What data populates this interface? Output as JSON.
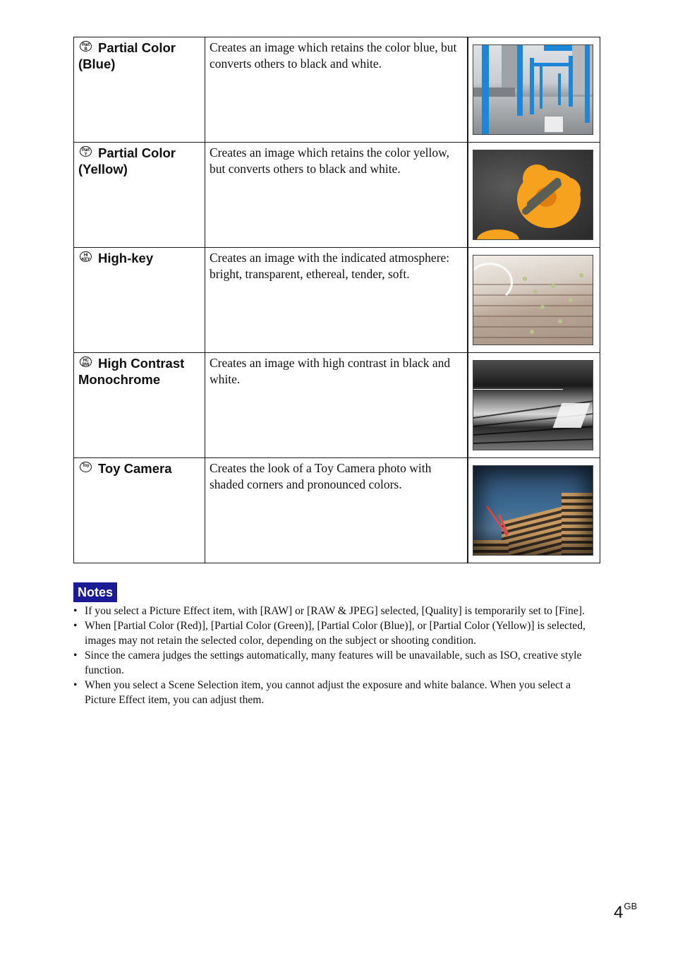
{
  "effects_table": {
    "rows": [
      {
        "icon": "partial-color-blue-icon",
        "icon_text": "Part B",
        "name": "Partial Color (Blue)",
        "description": "Creates an image which retains the color blue, but converts others to black and white.",
        "image_alt": "Blue-posted pergola walkway with black and white surroundings"
      },
      {
        "icon": "partial-color-yellow-icon",
        "icon_text": "Part Y",
        "name": "Partial Color (Yellow)",
        "description": "Creates an image which retains the color yellow, but converts others to black and white.",
        "image_alt": "Orange marigold flower with grasshopper on grey background"
      },
      {
        "icon": "high-key-icon",
        "icon_text": "HI KEY",
        "name": "High-key",
        "description": "Creates an image with the indicated atmosphere: bright, transparent, ethereal, tender, soft.",
        "image_alt": "Bright washed-out wooden deck with leaves"
      },
      {
        "icon": "high-contrast-monochrome-icon",
        "icon_text": "HC BW",
        "name": "High Contrast Monochrome",
        "description": "Creates an image with high contrast in black and white.",
        "image_alt": "High contrast black and white boardwalk by the water"
      },
      {
        "icon": "toy-camera-icon",
        "icon_text": "Toy",
        "name": "Toy Camera",
        "description": "Creates the look of a Toy Camera photo with shaded corners and pronounced colors.",
        "image_alt": "Building and crane with vignetted corners"
      }
    ]
  },
  "notes": {
    "label": "Notes",
    "bullet": "•",
    "items": [
      "If you select a Picture Effect item, with [RAW] or [RAW & JPEG] selected, [Quality] is temporarily set to [Fine].",
      "When [Partial Color (Red)], [Partial Color (Green)], [Partial Color (Blue)], or [Partial Color (Yellow)] is selected, images may not retain the selected color, depending on the subject or shooting condition.",
      "Since the camera judges the settings automatically, many features will be unavailable, such as ISO, creative style function.",
      "When you select a Scene Selection item, you cannot adjust the exposure and white balance. When you select a Picture Effect item, you can adjust them."
    ],
    "badge_color": "#1b1b96"
  },
  "page": {
    "number": "4",
    "suffix": "GB"
  }
}
